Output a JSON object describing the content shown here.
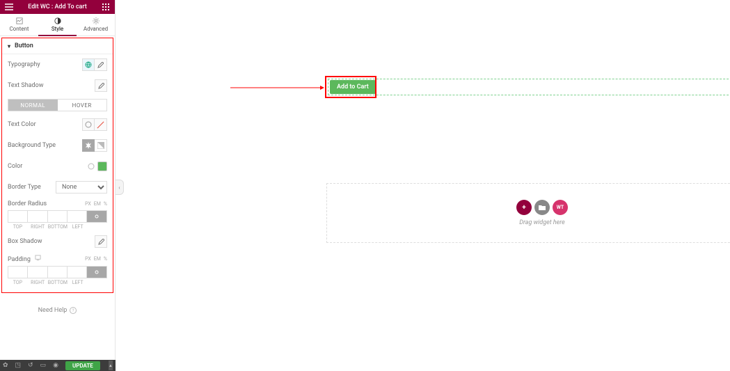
{
  "header": {
    "title": "Edit WC : Add To cart"
  },
  "tabs": {
    "content": "Content",
    "style": "Style",
    "advanced": "Advanced",
    "active": "style"
  },
  "section": {
    "title": "Button"
  },
  "fields": {
    "typography": "Typography",
    "text_shadow": "Text Shadow",
    "normal": "NORMAL",
    "hover": "HOVER",
    "text_color": "Text Color",
    "bg_type": "Background Type",
    "color": "Color",
    "color_swatch": "#5cb85c",
    "border_type": "Border Type",
    "border_type_value": "None",
    "border_radius": "Border Radius",
    "box_shadow": "Box Shadow",
    "padding": "Padding",
    "units_px": "PX",
    "units_em": "EM",
    "units_pct": "%",
    "top": "TOP",
    "right": "RIGHT",
    "bottom": "BOTTOM",
    "left": "LEFT"
  },
  "help": {
    "label": "Need Help"
  },
  "footer": {
    "update": "UPDATE"
  },
  "preview": {
    "button_label": "Add to Cart"
  },
  "dropzone": {
    "text": "Drag widget here"
  }
}
